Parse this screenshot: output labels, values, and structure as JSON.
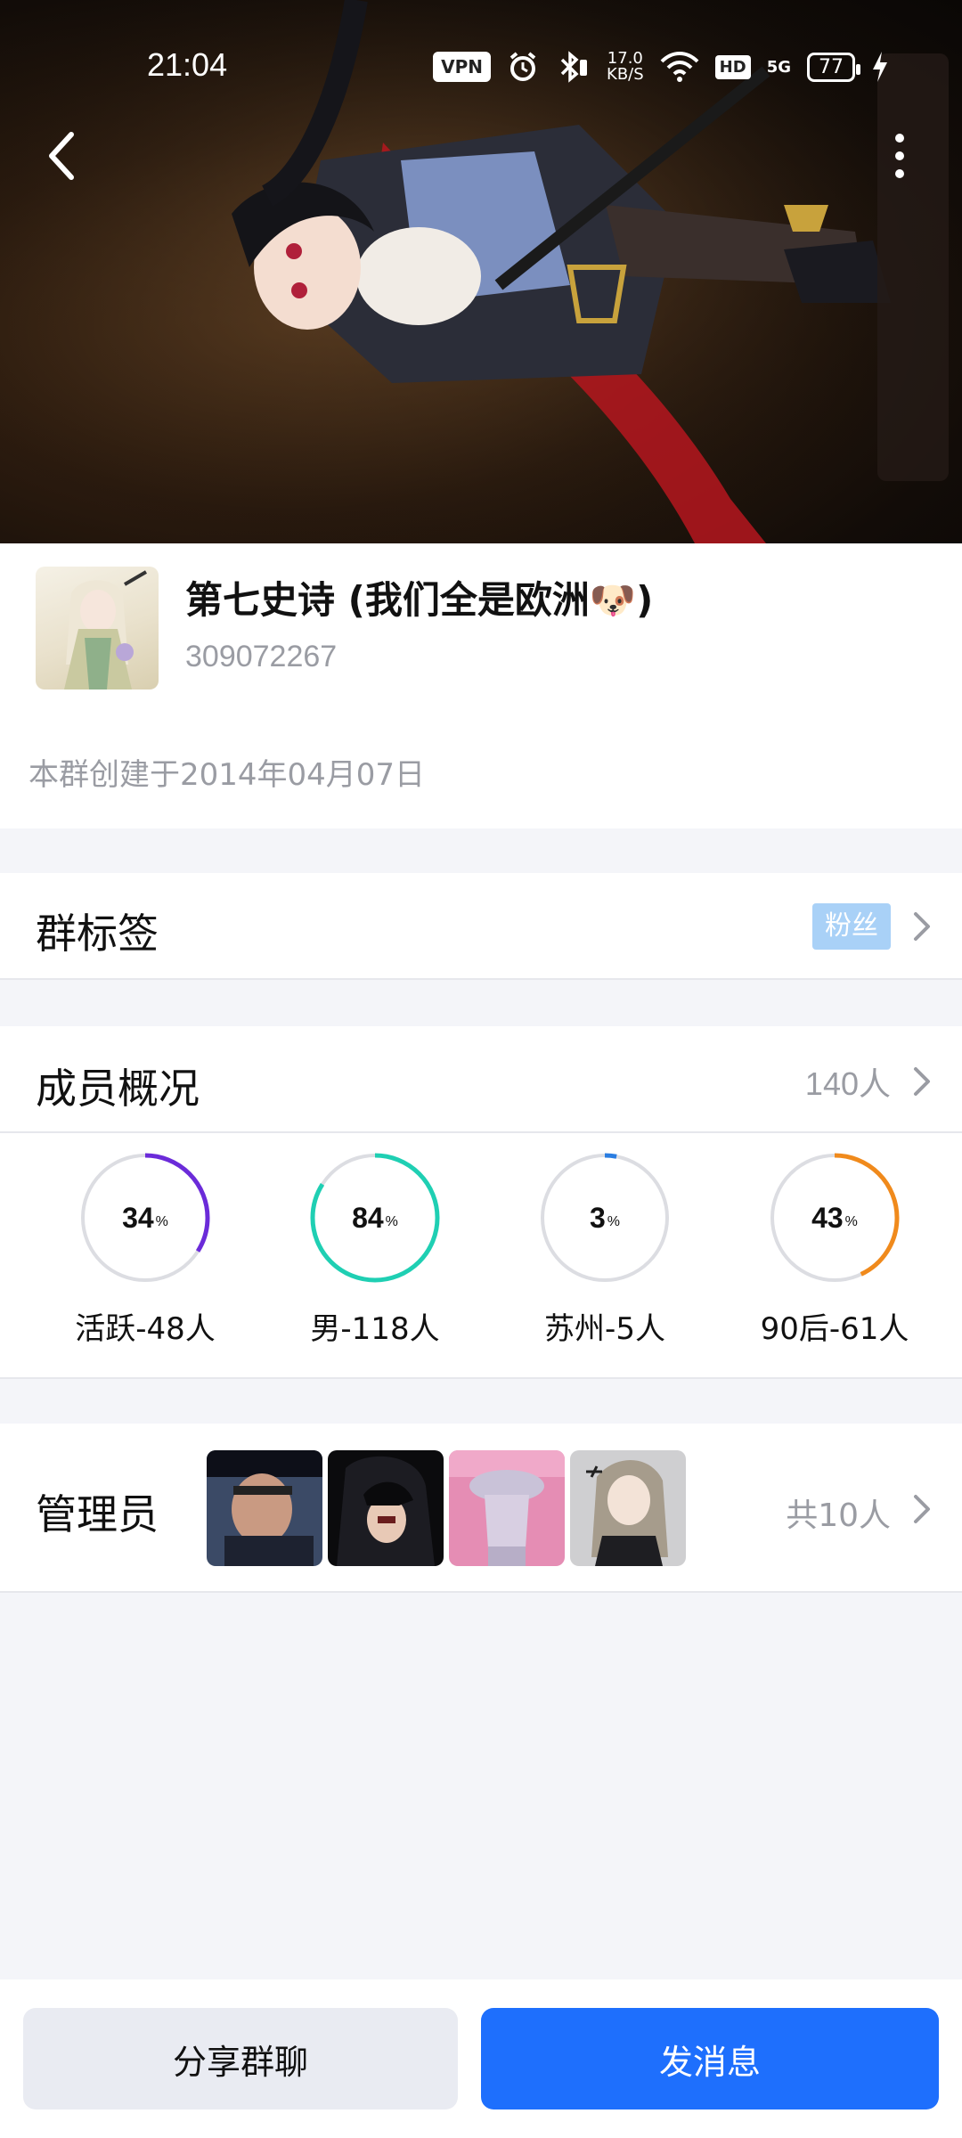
{
  "status_bar": {
    "time": "21:04",
    "vpn": "VPN",
    "speed_value": "17.0",
    "speed_unit": "KB/S",
    "hd": "HD",
    "network": "5G",
    "battery": "77"
  },
  "group": {
    "name": "第七史诗 (我们全是欧洲🐶)",
    "id": "309072267",
    "created": "本群创建于2014年04月07日"
  },
  "tags_row": {
    "title": "群标签",
    "tag": "粉丝"
  },
  "members_row": {
    "title": "成员概况",
    "count": "140人"
  },
  "stats": [
    {
      "value": "34",
      "percent": 34,
      "label": "活跃-48人",
      "color": "#6b2bd9"
    },
    {
      "value": "84",
      "percent": 84,
      "label": "男-118人",
      "color": "#1fcfb3"
    },
    {
      "value": "3",
      "percent": 3,
      "label": "苏州-5人",
      "color": "#2a7de1"
    },
    {
      "value": "43",
      "percent": 43,
      "label": "90后-61人",
      "color": "#f08a1c"
    }
  ],
  "pct_sign": "%",
  "admins_row": {
    "title": "管理员",
    "count": "共10人"
  },
  "buttons": {
    "share": "分享群聊",
    "send": "发消息"
  }
}
